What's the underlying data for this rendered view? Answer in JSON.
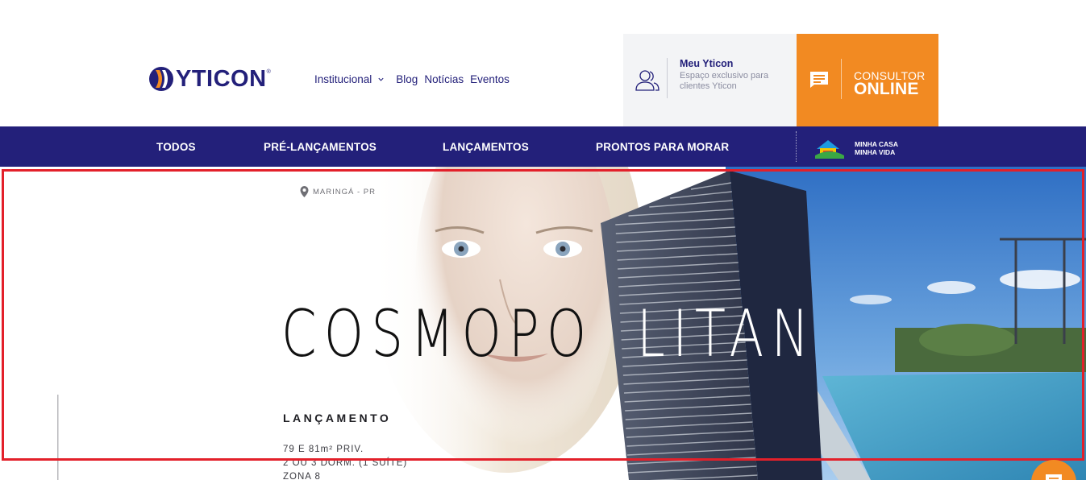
{
  "header": {
    "logo_text": "YTICON",
    "logo_reg": "®",
    "nav": [
      {
        "label": "Institucional",
        "has_dropdown": true
      },
      {
        "label": "Blog"
      },
      {
        "label": "Notícias"
      },
      {
        "label": "Eventos"
      }
    ],
    "meu_yticon": {
      "title": "Meu Yticon",
      "subtitle": "Espaço exclusivo para clientes Yticon"
    },
    "consultor": {
      "line1": "CONSULTOR",
      "line2": "ONLINE"
    }
  },
  "categories": {
    "items": [
      {
        "label": "TODOS"
      },
      {
        "label": "PRÉ-LANÇAMENTOS"
      },
      {
        "label": "LANÇAMENTOS"
      },
      {
        "label": "PRONTOS PARA MORAR"
      }
    ],
    "mcmv_line1": "MINHA CASA",
    "mcmv_line2": "MINHA VIDA"
  },
  "hero": {
    "location": "MARINGÁ - PR",
    "brand_dark": "COSMOPO",
    "brand_light": "LITAN",
    "status": "LANÇAMENTO",
    "specs": [
      "79 E 81m² PRIV.",
      "2 OU 3 DORM. (1 SUÍTE)",
      "ZONA 8"
    ]
  },
  "colors": {
    "brand_navy": "#23207a",
    "brand_orange": "#f28a22",
    "highlight_frame": "#e3202a"
  }
}
